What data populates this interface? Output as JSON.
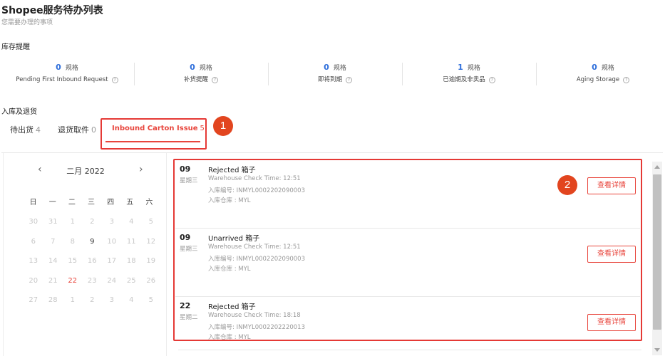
{
  "page": {
    "title": "Shopee服务待办列表",
    "subtitle": "您需要办理的事项"
  },
  "stock": {
    "title": "库存提醒",
    "unit": "规格",
    "items": [
      {
        "count": "0",
        "label": "Pending First Inbound Request"
      },
      {
        "count": "0",
        "label": "补货提醒"
      },
      {
        "count": "0",
        "label": "即将到期"
      },
      {
        "count": "1",
        "label": "已逾期及非卖品"
      },
      {
        "count": "0",
        "label": "Aging Storage"
      }
    ]
  },
  "inbound": {
    "title": "入库及退货",
    "tabs": [
      {
        "label": "待出货",
        "count": "4"
      },
      {
        "label": "退货取件",
        "count": "0"
      },
      {
        "label": "Inbound Carton Issue",
        "count": "5"
      }
    ]
  },
  "badges": {
    "one": "1",
    "two": "2"
  },
  "calendar": {
    "month": "二月 2022",
    "prev": "‹",
    "next": "›",
    "weekdays": [
      "日",
      "一",
      "二",
      "三",
      "四",
      "五",
      "六"
    ],
    "days": [
      {
        "d": "30",
        "t": "o"
      },
      {
        "d": "31",
        "t": "o"
      },
      {
        "d": "1",
        "t": "o"
      },
      {
        "d": "2",
        "t": "o"
      },
      {
        "d": "3",
        "t": "o"
      },
      {
        "d": "4",
        "t": "o"
      },
      {
        "d": "5",
        "t": "o"
      },
      {
        "d": "6",
        "t": "o"
      },
      {
        "d": "7",
        "t": "o"
      },
      {
        "d": "8",
        "t": "o"
      },
      {
        "d": "9",
        "t": "c"
      },
      {
        "d": "10",
        "t": "o"
      },
      {
        "d": "11",
        "t": "o"
      },
      {
        "d": "12",
        "t": "o"
      },
      {
        "d": "13",
        "t": "o"
      },
      {
        "d": "14",
        "t": "o"
      },
      {
        "d": "15",
        "t": "o"
      },
      {
        "d": "16",
        "t": "o"
      },
      {
        "d": "17",
        "t": "o"
      },
      {
        "d": "18",
        "t": "o"
      },
      {
        "d": "19",
        "t": "o"
      },
      {
        "d": "20",
        "t": "o"
      },
      {
        "d": "21",
        "t": "o"
      },
      {
        "d": "22",
        "t": "s"
      },
      {
        "d": "23",
        "t": "o"
      },
      {
        "d": "24",
        "t": "o"
      },
      {
        "d": "25",
        "t": "o"
      },
      {
        "d": "26",
        "t": "o"
      },
      {
        "d": "27",
        "t": "o"
      },
      {
        "d": "28",
        "t": "o"
      },
      {
        "d": "1",
        "t": "o"
      },
      {
        "d": "2",
        "t": "o"
      },
      {
        "d": "3",
        "t": "o"
      },
      {
        "d": "4",
        "t": "o"
      },
      {
        "d": "5",
        "t": "o"
      }
    ]
  },
  "issues": [
    {
      "day": "09",
      "weekday": "星期三",
      "title": "Rejected 箱子",
      "check_time": "Warehouse Check Time: 12:51",
      "inbound_no": "入库编号: INMYL0002202090003",
      "warehouse": "入库仓库 : MYL",
      "button": "查看详情"
    },
    {
      "day": "09",
      "weekday": "星期三",
      "title": "Unarrived 箱子",
      "check_time": "Warehouse Check Time: 12:51",
      "inbound_no": "入库编号: INMYL0002202090003",
      "warehouse": "入库仓库 : MYL",
      "button": "查看详情"
    },
    {
      "day": "22",
      "weekday": "星期二",
      "title": "Rejected 箱子",
      "check_time": "Warehouse Check Time: 18:18",
      "inbound_no": "入库编号: INMYL0002202220013",
      "warehouse": "入库仓库 : MYL",
      "button": "查看详情"
    }
  ],
  "colors": {
    "accent": "#e8453c",
    "highlight": "#e53935",
    "count_blue": "#2f6fdb"
  },
  "icons": {
    "help": "question-circle-icon",
    "prev": "chevron-left-icon",
    "next": "chevron-right-icon"
  }
}
